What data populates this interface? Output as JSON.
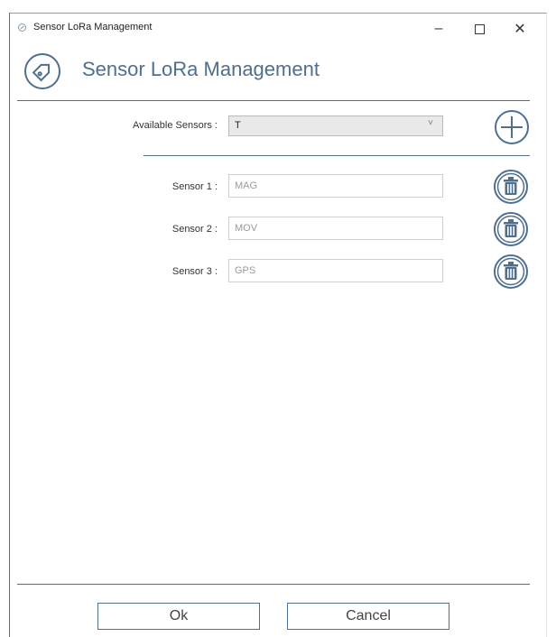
{
  "window": {
    "title": "Sensor LoRa Management",
    "controls": {
      "minimize": "–",
      "close": "✕"
    }
  },
  "header": {
    "title": "Sensor LoRa Management",
    "logo_icon": "tag-circle-icon"
  },
  "available_sensors": {
    "label": "Available Sensors :",
    "selected": "T",
    "chevron": "˅"
  },
  "sensors": [
    {
      "label": "Sensor 1 :",
      "value": "MAG"
    },
    {
      "label": "Sensor 2 :",
      "value": "MOV"
    },
    {
      "label": "Sensor 3 :",
      "value": "GPS"
    }
  ],
  "buttons": {
    "ok": "Ok",
    "cancel": "Cancel"
  },
  "colors": {
    "accent": "#4f6f8f"
  }
}
